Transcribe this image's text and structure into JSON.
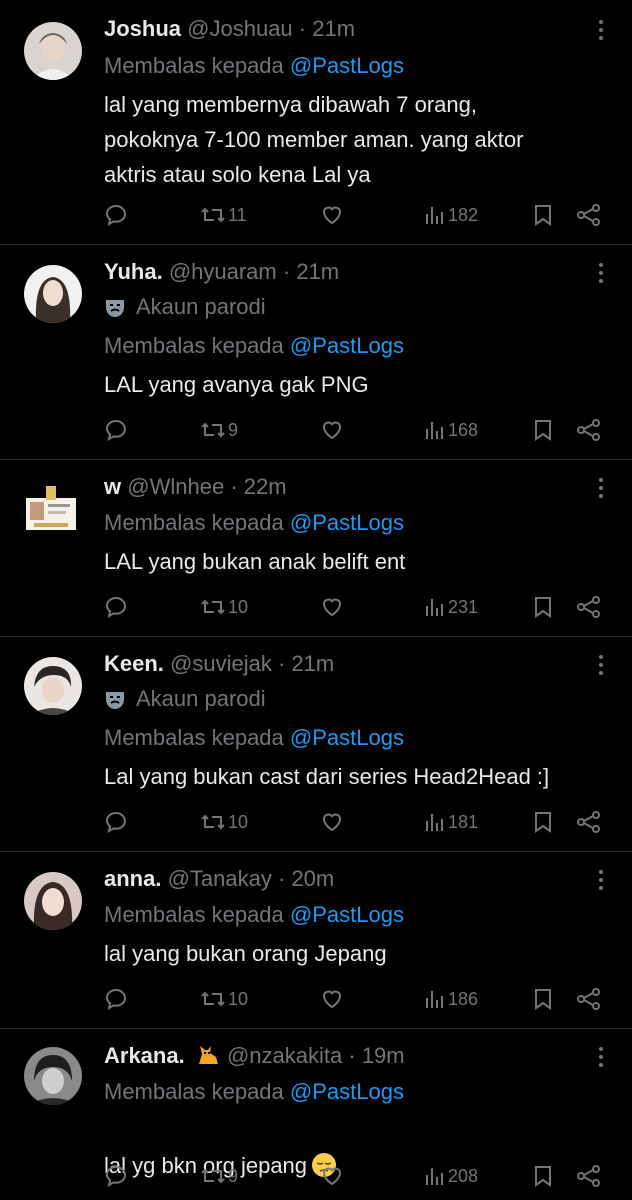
{
  "colors": {
    "background": "#000000",
    "text": "#e7e9ea",
    "secondary": "#71767b",
    "mention": "#1d9bf0",
    "divider": "#2f3336"
  },
  "reply_prefix": "Membalas kepada",
  "reply_target": "@PastLogs",
  "parody_label": "Akaun parodi",
  "tweets": [
    {
      "name": "Joshua",
      "handle": "@Joshuau",
      "time": "· 21m",
      "text": "lal yang membernya dibawah 7 orang,\npokoknya 7-100 member aman. yang aktor\naktris atau solo kena Lal ya",
      "retweets": "11",
      "views": "182",
      "avatar_icon": "avatar-photo"
    },
    {
      "name": "Yuha.",
      "handle": "@hyuaram",
      "time": "· 21m",
      "text": "LAL yang avanya gak PNG",
      "retweets": "9",
      "views": "168",
      "avatar_icon": "avatar-photo"
    },
    {
      "name": "w",
      "handle": "@Wlnhee",
      "time": "· 22m",
      "text": "LAL yang bukan anak belift ent",
      "retweets": "10",
      "views": "231",
      "avatar_icon": "id-card-image"
    },
    {
      "name": "Keen.",
      "handle": "@suviejak",
      "time": "· 21m",
      "text": "Lal yang bukan cast dari series Head2Head :]",
      "retweets": "10",
      "views": "181",
      "avatar_icon": "avatar-photo"
    },
    {
      "name": "anna.",
      "handle": "@Tanakay",
      "time": "· 20m",
      "text": "lal yang bukan orang Jepang",
      "retweets": "10",
      "views": "186",
      "avatar_icon": "avatar-photo"
    },
    {
      "name": "Arkana.",
      "handle": "@nzakakita",
      "time": "· 19m",
      "text": "lal yg bkn org jepang",
      "retweets": "9",
      "views": "208",
      "avatar_icon": "avatar-photo",
      "name_emoji": "cat-icon",
      "text_emoji": "pensive-face-icon"
    }
  ]
}
